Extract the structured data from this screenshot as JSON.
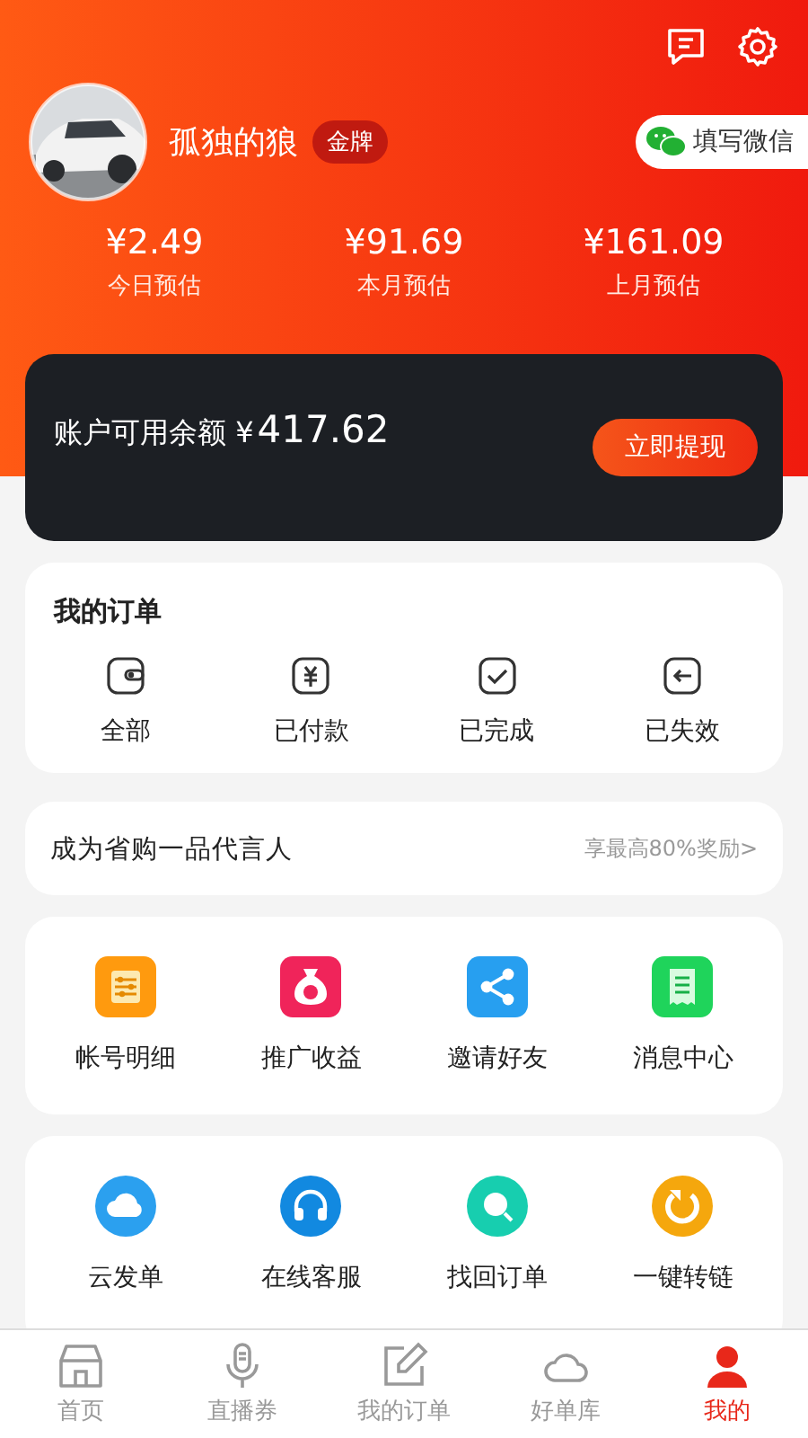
{
  "profile": {
    "name": "孤独的狼",
    "badge": "金牌",
    "wechat_button": "填写微信"
  },
  "stats": [
    {
      "amount": "¥2.49",
      "label": "今日预估"
    },
    {
      "amount": "¥91.69",
      "label": "本月预估"
    },
    {
      "amount": "¥161.09",
      "label": "上月预估"
    }
  ],
  "balance": {
    "label": "账户可用余额 ¥",
    "amount": "417.62",
    "button": "立即提现"
  },
  "orders": {
    "title": "我的订单",
    "items": [
      {
        "kind": "wallet",
        "label": "全部"
      },
      {
        "kind": "paid",
        "label": "已付款"
      },
      {
        "kind": "done",
        "label": "已完成"
      },
      {
        "kind": "expired",
        "label": "已失效"
      }
    ]
  },
  "promo": {
    "title": "成为省购一品代言人",
    "link": "享最高80%奖励>"
  },
  "tools": [
    {
      "kind": "sliders",
      "color": "#ff9a0e",
      "label": "帐号明细"
    },
    {
      "kind": "money",
      "color": "#f0245a",
      "label": "推广收益"
    },
    {
      "kind": "share",
      "color": "#279ff0",
      "label": "邀请好友"
    },
    {
      "kind": "receipt",
      "color": "#1fd45b",
      "label": "消息中心"
    }
  ],
  "services": [
    {
      "kind": "cloud",
      "color": "#2ba0ef",
      "label": "云发单"
    },
    {
      "kind": "headset",
      "color": "#1289e0",
      "label": "在线客服"
    },
    {
      "kind": "search",
      "color": "#17ceaf",
      "label": "找回订单"
    },
    {
      "kind": "refresh",
      "color": "#f5a70d",
      "label": "一键转链"
    }
  ],
  "tabs": [
    {
      "kind": "home",
      "label": "首页",
      "selected": false
    },
    {
      "kind": "mic",
      "label": "直播券",
      "selected": false
    },
    {
      "kind": "edit",
      "label": "我的订单",
      "selected": false
    },
    {
      "kind": "library",
      "label": "好单库",
      "selected": false
    },
    {
      "kind": "me",
      "label": "我的",
      "selected": true
    }
  ]
}
